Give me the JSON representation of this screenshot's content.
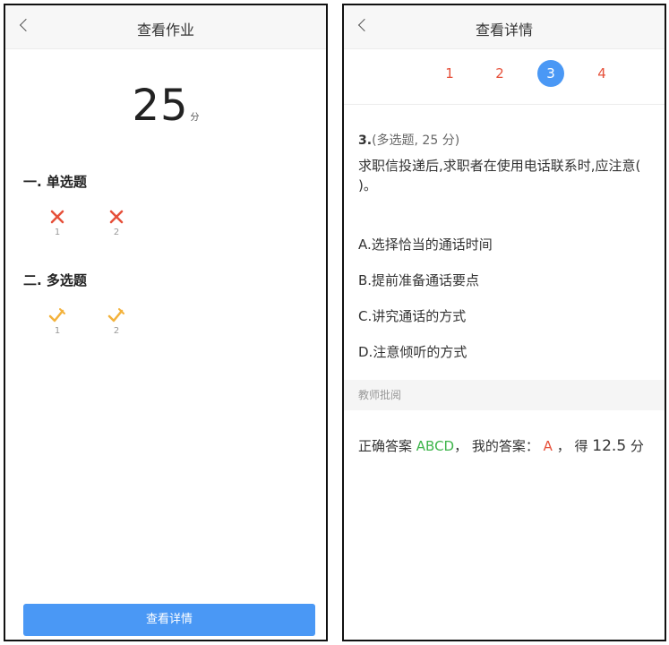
{
  "left": {
    "title": "查看作业",
    "score": "25",
    "score_unit": "分",
    "sections": [
      {
        "title": "一. 单选题",
        "items": [
          {
            "num": "1",
            "status": "wrong"
          },
          {
            "num": "2",
            "status": "wrong"
          }
        ]
      },
      {
        "title": "二. 多选题",
        "items": [
          {
            "num": "1",
            "status": "partial"
          },
          {
            "num": "2",
            "status": "partial"
          }
        ]
      }
    ],
    "detail_button": "查看详情"
  },
  "right": {
    "title": "查看详情",
    "tabs": [
      "1",
      "2",
      "3",
      "4"
    ],
    "active_tab": "3",
    "question": {
      "number": "3.",
      "meta": "(多选题,  25 分)",
      "text": "求职信投递后,求职者在使用电话联系时,应注意(   )。",
      "options": [
        "A.选择恰当的通话时间",
        "B.提前准备通话要点",
        "C.讲究通话的方式",
        "D.注意倾听的方式"
      ]
    },
    "review_label": "教师批阅",
    "result": {
      "prefix": "正确答案",
      "correct_answer": "ABCD",
      "sep1": "，  我的答案：",
      "my_answer": "A",
      "sep2": "， 得",
      "score": "12.5",
      "unit": "分"
    }
  },
  "colors": {
    "accent": "#4a98f5",
    "wrong": "#e6503a",
    "partial": "#f3b23c",
    "correct": "#3db44a"
  },
  "icons": {
    "wrong": "cross-icon",
    "partial": "half-check-icon",
    "back": "chevron-left-icon"
  }
}
